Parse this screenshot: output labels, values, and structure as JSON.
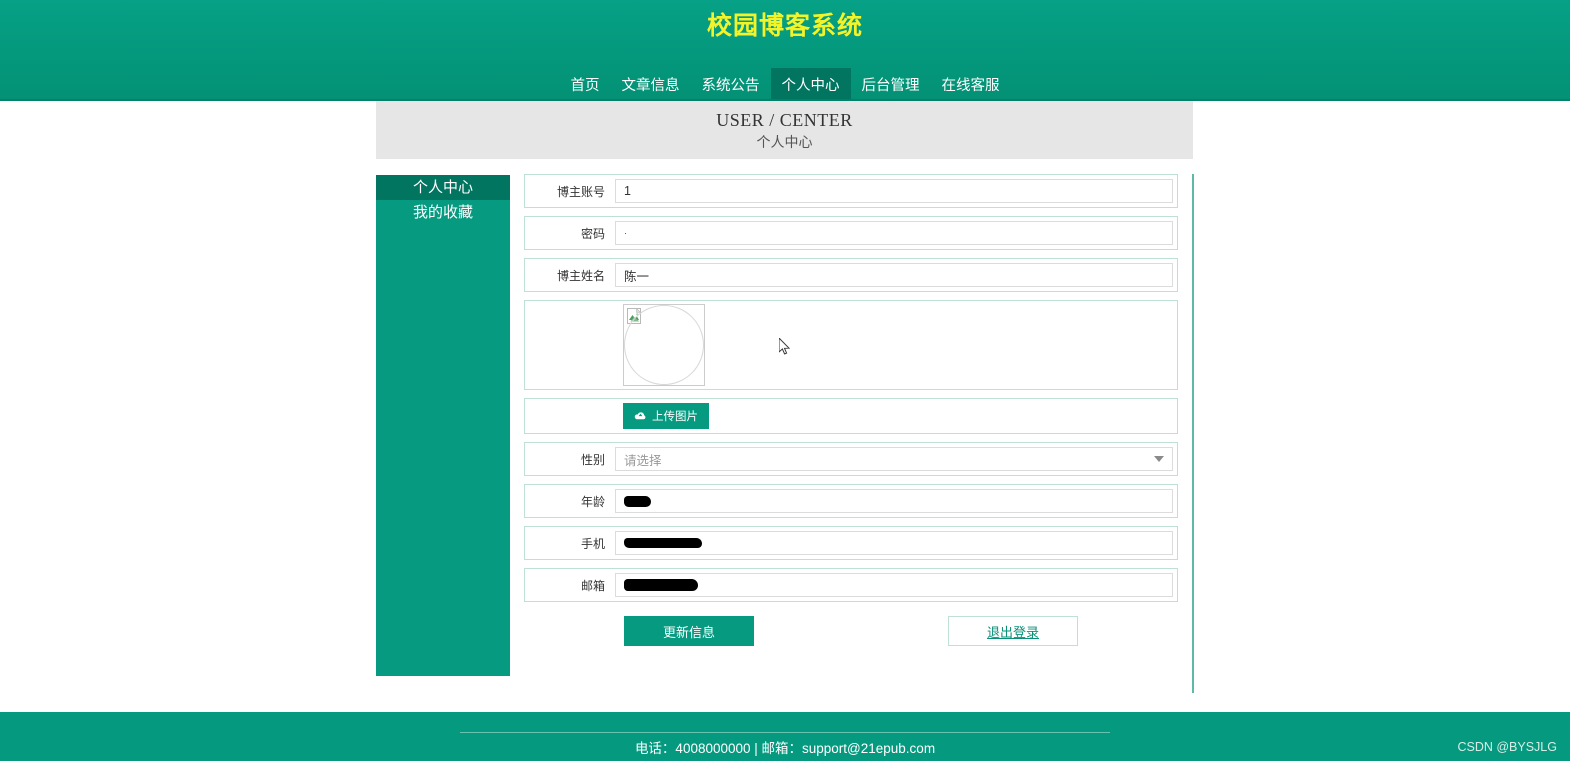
{
  "header": {
    "site_title": "校园博客系统",
    "title_color": "#f3f32a",
    "brand_color": "#059a7f",
    "active_nav_color": "#017560",
    "nav": [
      {
        "label": "首页",
        "active": false
      },
      {
        "label": "文章信息",
        "active": false
      },
      {
        "label": "系统公告",
        "active": false
      },
      {
        "label": "个人中心",
        "active": true
      },
      {
        "label": "后台管理",
        "active": false
      },
      {
        "label": "在线客服",
        "active": false
      }
    ]
  },
  "banner": {
    "title_en": "USER / CENTER",
    "title_cn": "个人中心"
  },
  "sidebar": {
    "items": [
      {
        "label": "个人中心",
        "active": true
      },
      {
        "label": "我的收藏",
        "active": false
      }
    ]
  },
  "form": {
    "fields": [
      {
        "label": "博主账号",
        "value": "1",
        "type": "text"
      },
      {
        "label": "密码",
        "value": "·",
        "type": "password"
      },
      {
        "label": "博主姓名",
        "value": "陈一",
        "type": "text"
      },
      {
        "label": "性别",
        "value": "请选择",
        "type": "select"
      },
      {
        "label": "年龄",
        "value": "",
        "type": "redacted"
      },
      {
        "label": "手机",
        "value": "",
        "type": "redacted"
      },
      {
        "label": "邮箱",
        "value": "",
        "type": "redacted"
      }
    ],
    "avatar": {
      "icon": "broken-image-icon",
      "alt": ""
    },
    "upload_button": {
      "label": "上传图片",
      "icon": "cloud-upload-icon"
    },
    "submit_button": "更新信息",
    "logout_button": "退出登录"
  },
  "footer": {
    "contact": "电话：4008000000 | 邮箱：support@21epub.com",
    "watermark": "CSDN @BYSJLG"
  }
}
